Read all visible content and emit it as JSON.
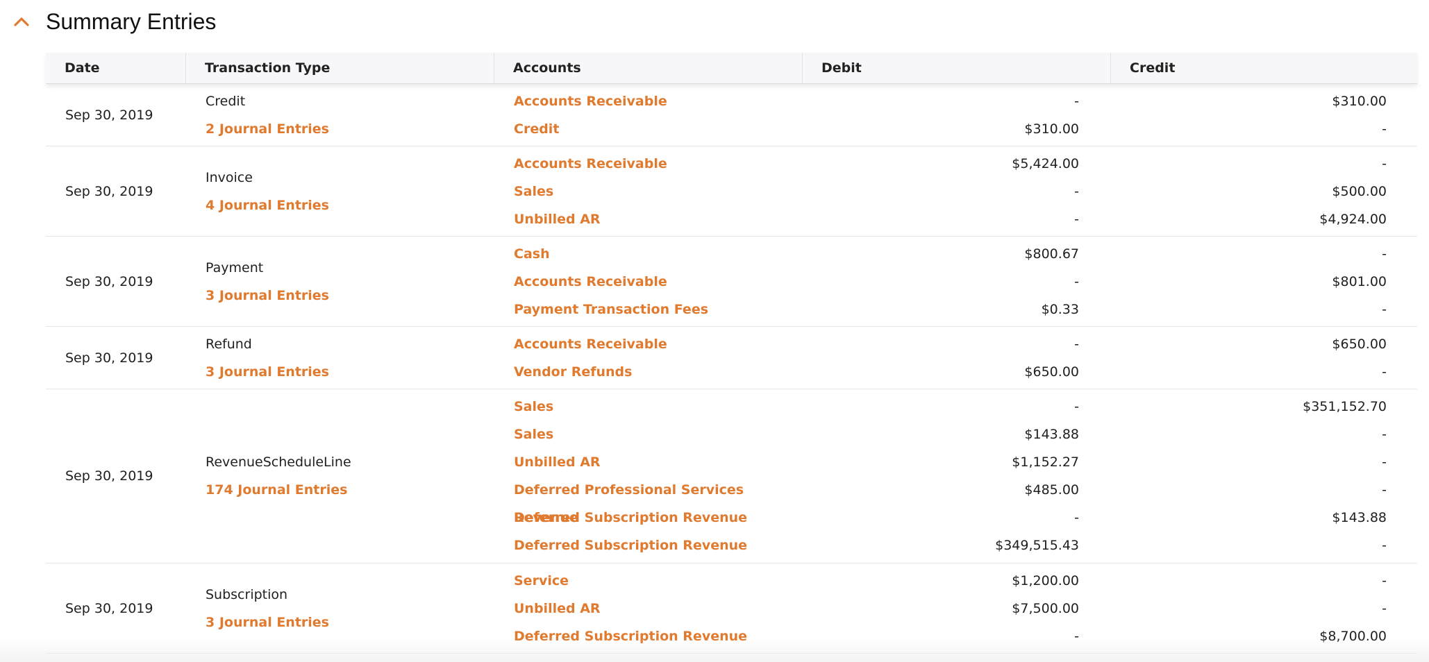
{
  "section": {
    "title": "Summary Entries",
    "accent_color": "#e07a2e",
    "collapse_icon": "chevron-up-icon"
  },
  "table": {
    "headers": {
      "date": "Date",
      "transaction_type": "Transaction Type",
      "accounts": "Accounts",
      "debit": "Debit",
      "credit": "Credit"
    },
    "rows": [
      {
        "date": "Sep 30, 2019",
        "type": "Credit",
        "journal": "2 Journal Entries",
        "lines": [
          {
            "account": "Accounts Receivable",
            "debit": "-",
            "credit": "$310.00"
          },
          {
            "account": "Credit",
            "debit": "$310.00",
            "credit": "-"
          }
        ]
      },
      {
        "date": "Sep 30, 2019",
        "type": "Invoice",
        "journal": "4 Journal Entries",
        "lines": [
          {
            "account": "Accounts Receivable",
            "debit": "$5,424.00",
            "credit": "-"
          },
          {
            "account": "Sales",
            "debit": "-",
            "credit": "$500.00"
          },
          {
            "account": "Unbilled AR",
            "debit": "-",
            "credit": "$4,924.00"
          }
        ]
      },
      {
        "date": "Sep 30, 2019",
        "type": "Payment",
        "journal": "3 Journal Entries",
        "lines": [
          {
            "account": "Cash",
            "debit": "$800.67",
            "credit": "-"
          },
          {
            "account": "Accounts Receivable",
            "debit": "-",
            "credit": "$801.00"
          },
          {
            "account": "Payment Transaction Fees",
            "debit": "$0.33",
            "credit": "-"
          }
        ]
      },
      {
        "date": "Sep 30, 2019",
        "type": "Refund",
        "journal": "3 Journal Entries",
        "lines": [
          {
            "account": "Accounts Receivable",
            "debit": "-",
            "credit": "$650.00"
          },
          {
            "account": "Vendor Refunds",
            "debit": "$650.00",
            "credit": "-"
          }
        ]
      },
      {
        "date": "Sep 30, 2019",
        "type": "RevenueScheduleLine",
        "journal": "174 Journal Entries",
        "lines": [
          {
            "account": "Sales",
            "debit": "-",
            "credit": "$351,152.70"
          },
          {
            "account": "Sales",
            "debit": "$143.88",
            "credit": "-"
          },
          {
            "account": "Unbilled AR",
            "debit": "$1,152.27",
            "credit": "-"
          },
          {
            "account": "Deferred Professional Services Revenue",
            "debit": "$485.00",
            "credit": "-"
          },
          {
            "account": "Deferred Subscription Revenue",
            "debit": "-",
            "credit": "$143.88"
          },
          {
            "account": "Deferred Subscription Revenue",
            "debit": "$349,515.43",
            "credit": "-"
          }
        ]
      },
      {
        "date": "Sep 30, 2019",
        "type": "Subscription",
        "journal": "3 Journal Entries",
        "lines": [
          {
            "account": "Service",
            "debit": "$1,200.00",
            "credit": "-"
          },
          {
            "account": "Unbilled AR",
            "debit": "$7,500.00",
            "credit": "-"
          },
          {
            "account": "Deferred Subscription Revenue",
            "debit": "-",
            "credit": "$8,700.00"
          }
        ]
      }
    ]
  }
}
